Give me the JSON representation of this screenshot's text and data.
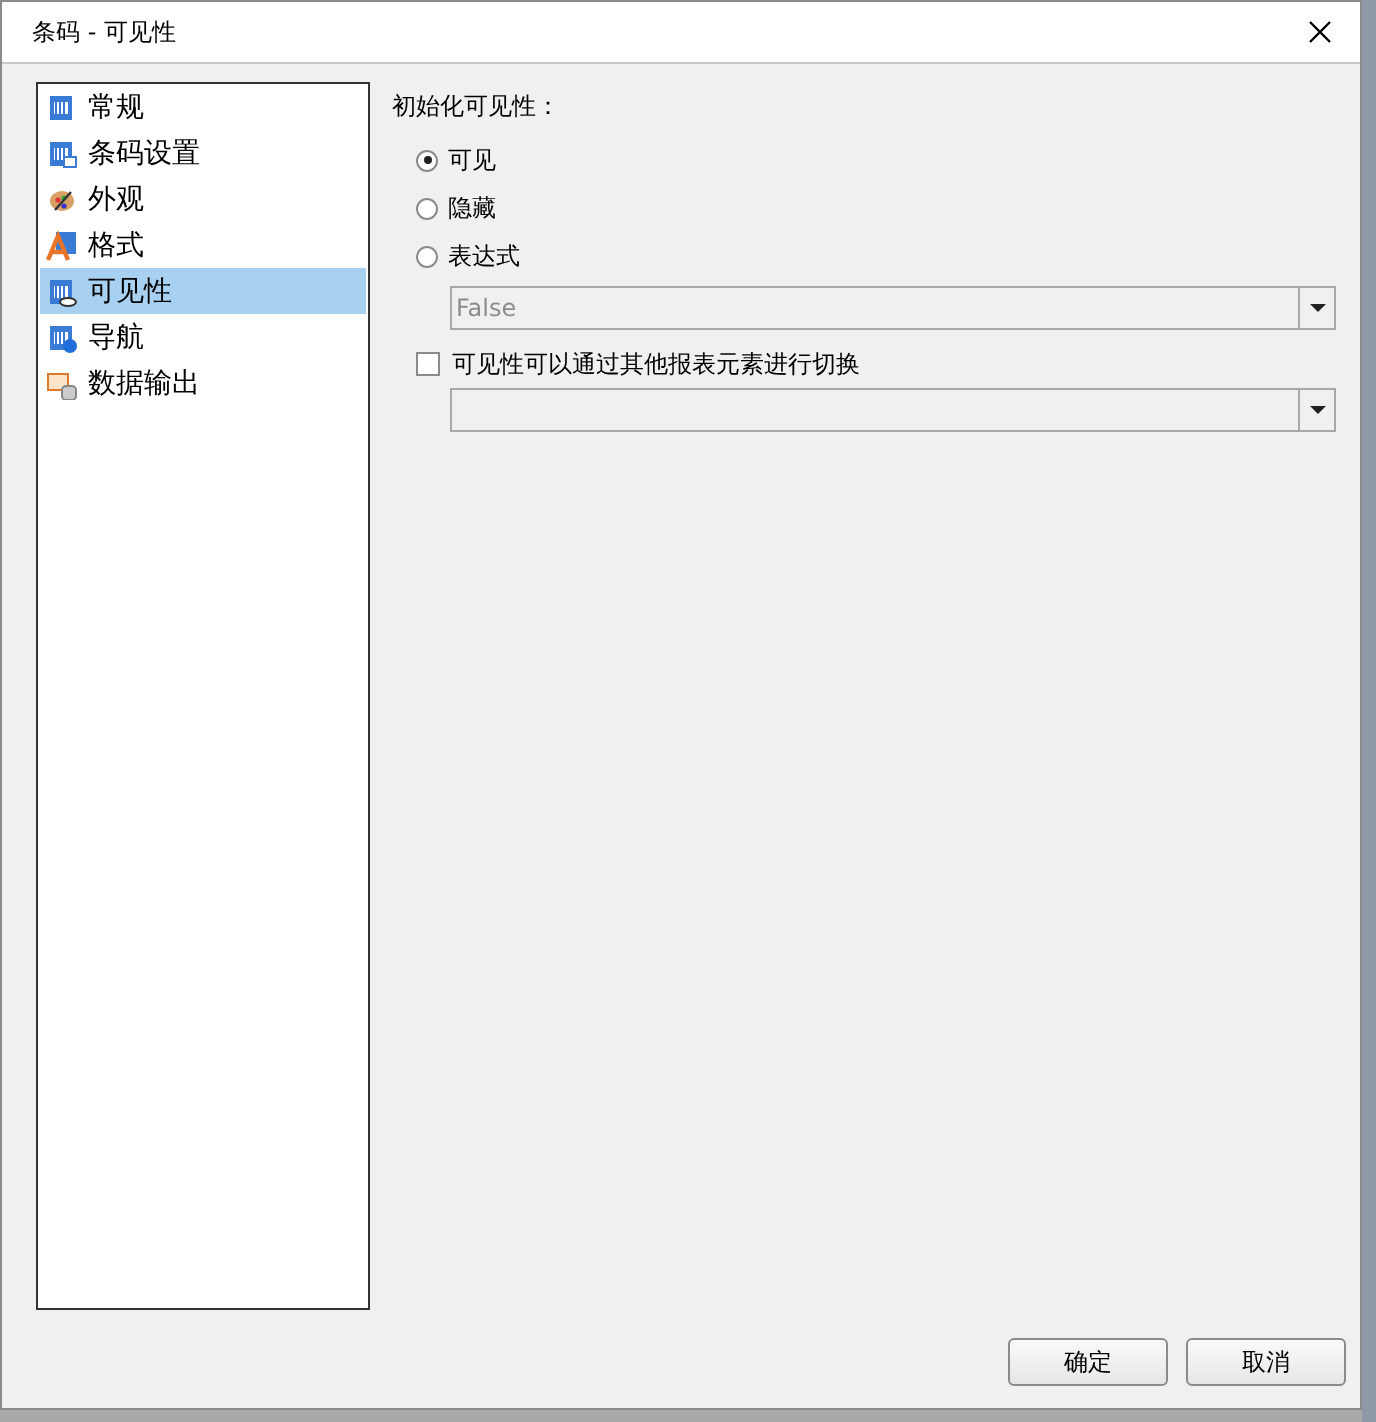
{
  "window": {
    "title": "条码 - 可见性"
  },
  "sidebar": {
    "items": [
      {
        "label": "常规",
        "selected": false
      },
      {
        "label": "条码设置",
        "selected": false
      },
      {
        "label": "外观",
        "selected": false
      },
      {
        "label": "格式",
        "selected": false
      },
      {
        "label": "可见性",
        "selected": true
      },
      {
        "label": "导航",
        "selected": false
      },
      {
        "label": "数据输出",
        "selected": false
      }
    ]
  },
  "visibility": {
    "heading": "初始化可见性：",
    "options": [
      {
        "label": "可见",
        "selected": true
      },
      {
        "label": "隐藏",
        "selected": false
      },
      {
        "label": "表达式",
        "selected": false
      }
    ],
    "expression": {
      "value": "False",
      "disabled": true
    },
    "toggle": {
      "label": "可见性可以通过其他报表元素进行切换",
      "checked": false
    }
  },
  "buttons": [
    "确定",
    "取消"
  ]
}
